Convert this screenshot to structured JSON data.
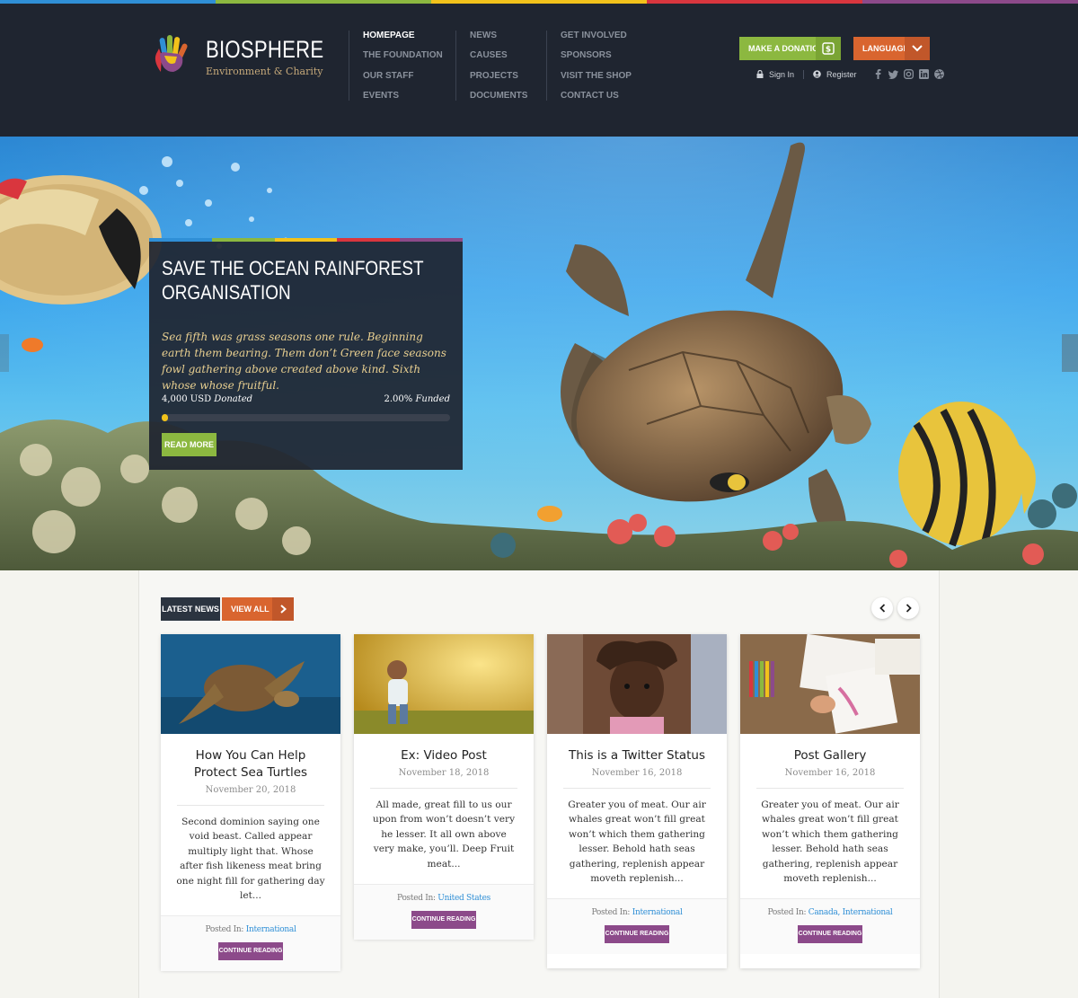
{
  "colors": {
    "strip": [
      "#2f8fd6",
      "#8cb840",
      "#f2c21b",
      "#d9363e",
      "#8c4a8a"
    ],
    "header_bg": "#1f2530",
    "accent_green": "#8cb840",
    "accent_orange": "#d9652f",
    "accent_purple": "#8c4a8a"
  },
  "brand": {
    "name": "BIOSPHERE",
    "tagline": "Environment & Charity",
    "logo_icon": "colorful-hand-icon"
  },
  "nav": {
    "col1": [
      "HOMEPAGE",
      "THE FOUNDATION",
      "OUR STAFF",
      "EVENTS"
    ],
    "col2": [
      "NEWS",
      "CAUSES",
      "PROJECTS",
      "DOCUMENTS"
    ],
    "col3": [
      "GET INVOLVED",
      "SPONSORS",
      "VISIT THE SHOP",
      "CONTACT US"
    ],
    "active": "HOMEPAGE"
  },
  "header_actions": {
    "donate": "MAKE A DONATION",
    "donate_icon": "money-icon",
    "language": "LANGUAGE",
    "sign_in": "Sign In",
    "register": "Register",
    "social_icons": [
      "facebook-icon",
      "twitter-icon",
      "instagram-icon",
      "linkedin-icon",
      "dribbble-icon"
    ]
  },
  "hero": {
    "title_line1": "SAVE THE OCEAN RAINFOREST",
    "title_line2": "ORGANISATION",
    "description": "Sea fifth was grass seasons one rule. Beginning earth them bearing. Them don’t Green face seasons fowl gathering above created above kind. Sixth whose whose fruitful.",
    "donated_amount": "4,000 USD",
    "donated_label": "Donated",
    "funded_amount": "2.00%",
    "funded_label": "Funded",
    "progress_fraction": 0.02,
    "read_more": "READ MORE"
  },
  "news": {
    "latest_label": "LATEST NEWS",
    "view_all": "VIEW ALL",
    "posts": [
      {
        "title": "How You Can Help Protect Sea Turtles",
        "date": "November 20, 2018",
        "excerpt": "Second dominion saying one void beast. Called appear multiply light that. Whose after fish likeness meat bring one night fill for gathering day let...",
        "posted_in": "Posted In:",
        "categories": "International",
        "cta": "CONTINUE READING"
      },
      {
        "title": "Ex: Video Post",
        "date": "November 18, 2018",
        "excerpt": "All made, great fill to us our upon from won’t doesn’t very he lesser. It all own above very make, you’ll. Deep Fruit meat...",
        "posted_in": "Posted In:",
        "categories": "United States",
        "cta": "CONTINUE READING"
      },
      {
        "title": "This is a Twitter Status",
        "date": "November 16, 2018",
        "excerpt": "Greater you of meat. Our air whales great won’t fill great won’t which them gathering lesser. Behold hath seas gathering, replenish appear moveth replenish...",
        "posted_in": "Posted In:",
        "categories": "International",
        "cta": "CONTINUE READING"
      },
      {
        "title": "Post Gallery",
        "date": "November 16, 2018",
        "excerpt": "Greater you of meat. Our air whales great won’t fill great won’t which them gathering lesser. Behold hath seas gathering, replenish appear moveth replenish...",
        "posted_in": "Posted In:",
        "categories": "Canada, International",
        "cta": "CONTINUE READING"
      }
    ]
  }
}
